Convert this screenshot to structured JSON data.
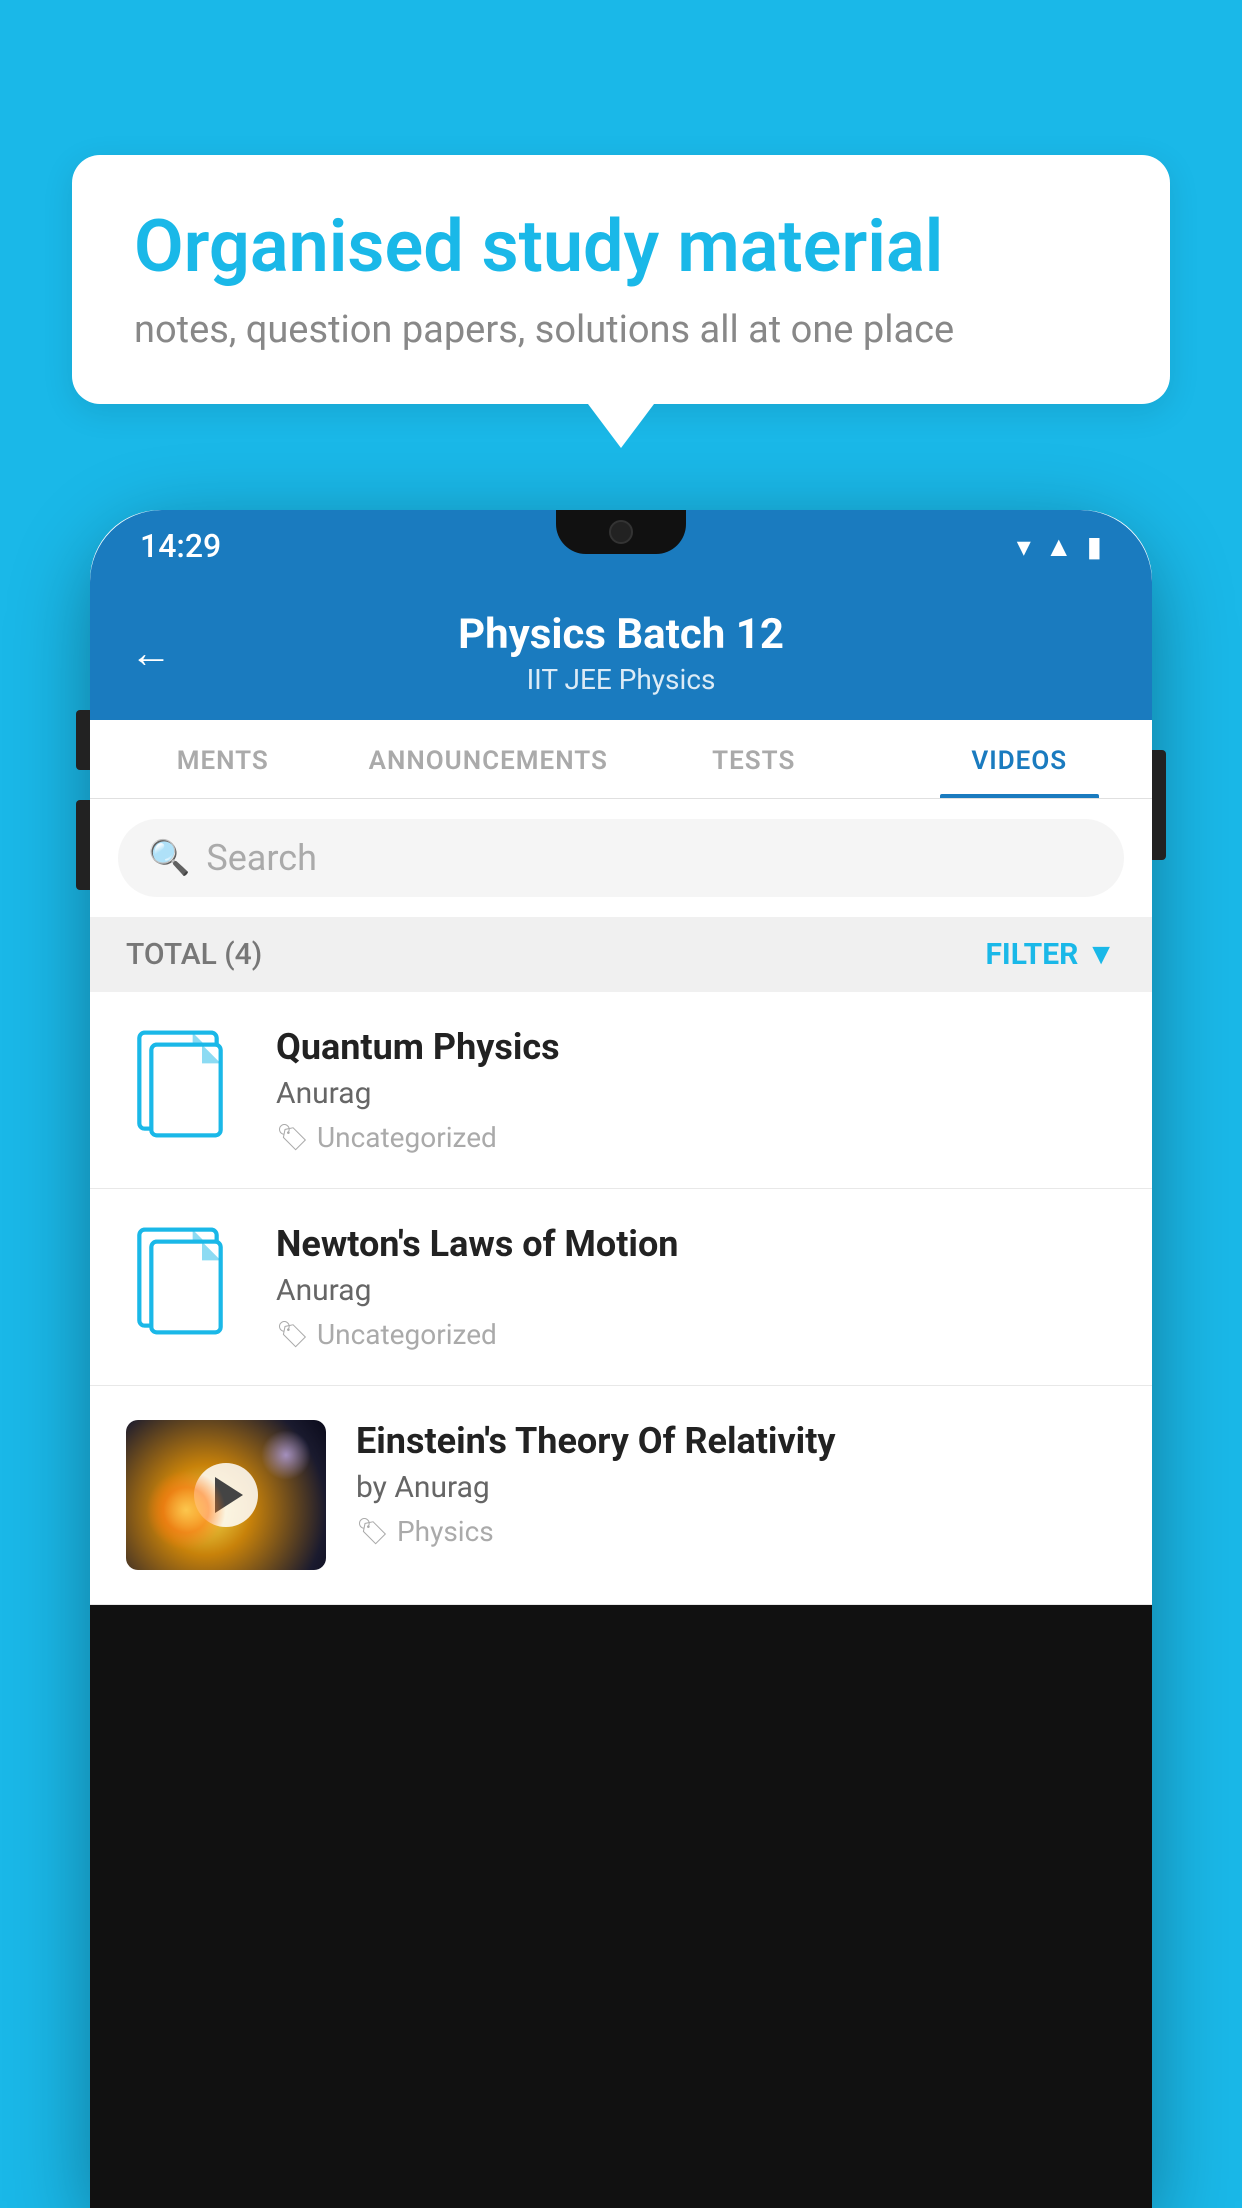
{
  "background_color": "#1ab8e8",
  "bubble": {
    "title": "Organised study material",
    "subtitle": "notes, question papers, solutions all at one place"
  },
  "phone": {
    "status_bar": {
      "time": "14:29"
    },
    "header": {
      "title": "Physics Batch 12",
      "subtitle": "IIT JEE    Physics",
      "back_label": "←"
    },
    "tabs": [
      {
        "label": "MENTS",
        "active": false
      },
      {
        "label": "ANNOUNCEMENTS",
        "active": false
      },
      {
        "label": "TESTS",
        "active": false
      },
      {
        "label": "VIDEOS",
        "active": true
      }
    ],
    "search": {
      "placeholder": "Search"
    },
    "filter_row": {
      "total": "TOTAL (4)",
      "filter_label": "FILTER"
    },
    "videos": [
      {
        "title": "Quantum Physics",
        "author": "Anurag",
        "tag": "Uncategorized",
        "has_thumb": false
      },
      {
        "title": "Newton's Laws of Motion",
        "author": "Anurag",
        "tag": "Uncategorized",
        "has_thumb": false
      },
      {
        "title": "Einstein's Theory Of Relativity",
        "author": "by Anurag",
        "tag": "Physics",
        "has_thumb": true
      }
    ]
  }
}
